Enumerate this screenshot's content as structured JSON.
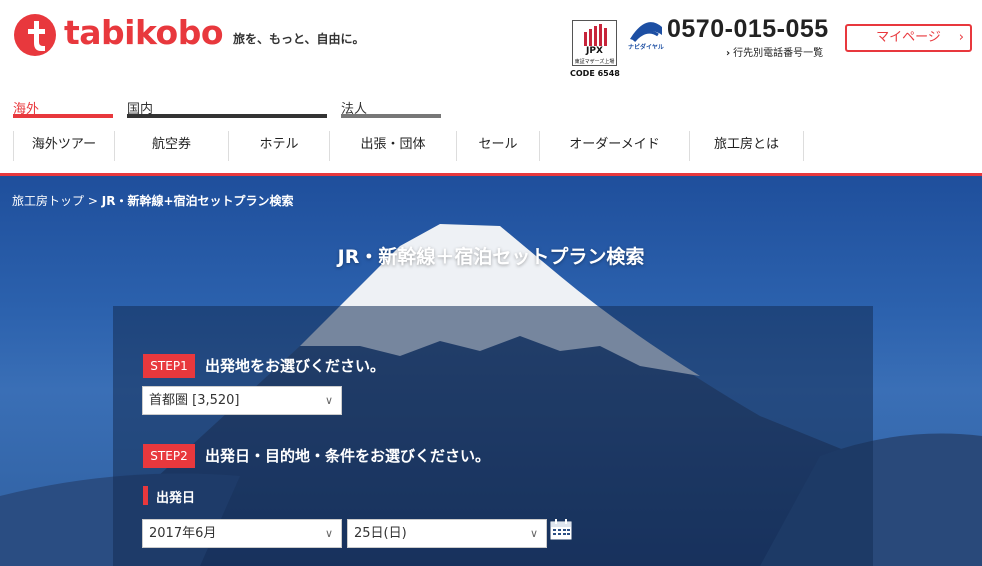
{
  "header": {
    "logo_text": "tabikobo",
    "tagline": "旅を、もっと、自由に。",
    "jpx_label": "JPX",
    "jpx_sub": "東証マザーズ上場",
    "jpx_code": "CODE 6548",
    "navidial_label": "ナビダイヤル",
    "phone": "0570-015-055",
    "phone_sub": "行先別電話番号一覧",
    "mypage": "マイページ"
  },
  "categories": [
    {
      "label": "海外",
      "color": "#e8383d"
    },
    {
      "label": "国内"
    },
    {
      "label": "法人"
    }
  ],
  "subnav": [
    "海外ツアー",
    "航空券",
    "ホテル",
    "出張・団体",
    "セール",
    "オーダーメイド",
    "旅工房とは"
  ],
  "breadcrumb": {
    "home": "旅工房トップ",
    "sep": ">",
    "current": "JR・新幹線+宿泊セットプラン検索"
  },
  "hero": {
    "title": "JR・新幹線＋宿泊セットプラン検索"
  },
  "search": {
    "step1": {
      "badge": "STEP1",
      "text": "出発地をお選びください。",
      "value": "首都圏 [3,520]"
    },
    "step2": {
      "badge": "STEP2",
      "text": "出発日・目的地・条件をお選びください。"
    },
    "departure_date": {
      "label": "出発日",
      "month": "2017年6月",
      "day": "25日(日)"
    }
  },
  "colors": {
    "brand_red": "#e8383d",
    "sky_blue": "#2c62ae"
  },
  "icons": [
    "tabikobo-logo-icon",
    "jpx-icon",
    "navidial-icon",
    "chevron-right-icon",
    "chevron-down-icon",
    "calendar-icon"
  ]
}
